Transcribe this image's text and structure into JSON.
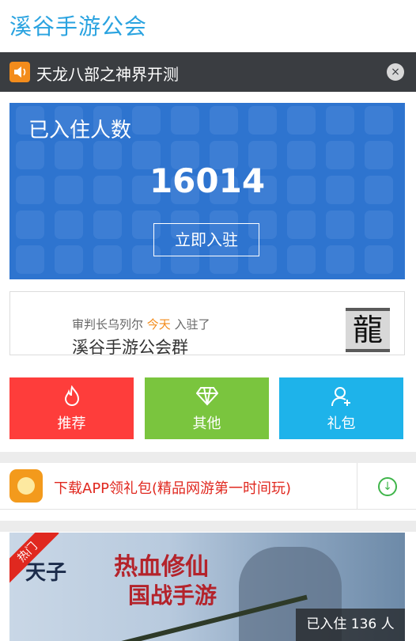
{
  "header": {
    "title": "溪谷手游公会"
  },
  "notice": {
    "text": "天龙八部之神界开测",
    "close": "×"
  },
  "banner": {
    "label": "已入住人数",
    "count": "16014",
    "join_label": "立即入驻"
  },
  "activity": {
    "user": "审判长乌列尔",
    "when": "今天",
    "action": "入驻了",
    "group": "溪谷手游公会群",
    "thumb_glyph": "龍"
  },
  "categories": [
    {
      "label": "推荐",
      "icon": "flame-icon",
      "color": "#fe3d3b"
    },
    {
      "label": "其他",
      "icon": "diamond-icon",
      "color": "#7ac53e"
    },
    {
      "label": "礼包",
      "icon": "user-add-icon",
      "color": "#1eb3ea"
    }
  ],
  "promo": {
    "text": "下载APP领礼包(精品网游第一时间玩)"
  },
  "game_card": {
    "ribbon": "热门",
    "joined": "已入住 136 人",
    "logo": "天子",
    "slogan1": "热血修仙",
    "slogan2": "国战手游"
  }
}
